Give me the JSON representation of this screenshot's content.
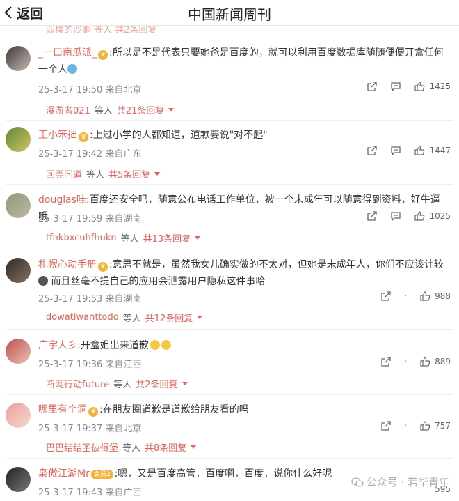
{
  "header": {
    "back_label": "返回",
    "title": "中国新闻周刊"
  },
  "partial_top": "四楼的沙鹏 等人 共2条回复",
  "comments": [
    {
      "user": "_一口南瓜派_",
      "text": ":所以是不是代表只要她爸是百度的，就可以利用百度数据库随随便便开盒任何一个人",
      "time": "25-3-17 19:50",
      "location": "来自北京",
      "likes": "1425",
      "reply_user": "漫游者021",
      "reply_mid": "等人",
      "reply_count": "共21条回复"
    },
    {
      "user": "王小笨拙",
      "text": ":上过小学的人都知道，道歉要说\"对不起\"",
      "time": "25-3-17 19:42",
      "location": "来自广东",
      "likes": "1447",
      "reply_user": "回莞问道",
      "reply_mid": "等人",
      "reply_count": "共5条回复"
    },
    {
      "user": "douglas哇",
      "text": ":百度还安全吗，随意公布电话工作单位，被一个未成年可以随意得到资料，好牛逼哦",
      "time": "25-3-17 19:59",
      "location": "来自湖南",
      "likes": "1025",
      "reply_user": "tfhkbxcuhfhukn",
      "reply_mid": "等人",
      "reply_count": "共13条回复"
    },
    {
      "user": "札幌心动手册",
      "text": ":意思不就是，虽然我女儿确实做的不太对，但她是未成年人，你们不应该计较",
      "text2": "而且丝毫不提自己的应用会泄露用户隐私这件事哈",
      "time": "25-3-17 19:53",
      "location": "来自湖南",
      "likes": "988",
      "reply_user": "dowatiwanttodo",
      "reply_mid": "等人",
      "reply_count": "共12条回复"
    },
    {
      "user": "广宇人彡",
      "text": ":开盒姐出来道歉",
      "time": "25-3-17 19:36",
      "location": "来自江西",
      "likes": "889",
      "reply_user": "断网行动future",
      "reply_mid": "等人",
      "reply_count": "共2条回复"
    },
    {
      "user": "哪里有个洞",
      "text": ":在朋友圈道歉是道歉给朋友看的吗",
      "time": "25-3-17 19:37",
      "location": "来自北京",
      "likes": "757",
      "reply_user": "巴巴结结圣彼得堡",
      "reply_mid": "等人",
      "reply_count": "共8条回复"
    },
    {
      "user": "枭傲江湖Mr",
      "vip": "会员2",
      "text": ":嗯，又是百度高管，百度啊，百度，说你什么好呢",
      "time": "25-3-17 19:43",
      "location": "来自广西",
      "likes": "595"
    }
  ],
  "watermark": "公众号 · 若华青年",
  "colors": {
    "accent": "#e0645a",
    "meta": "#888888"
  }
}
